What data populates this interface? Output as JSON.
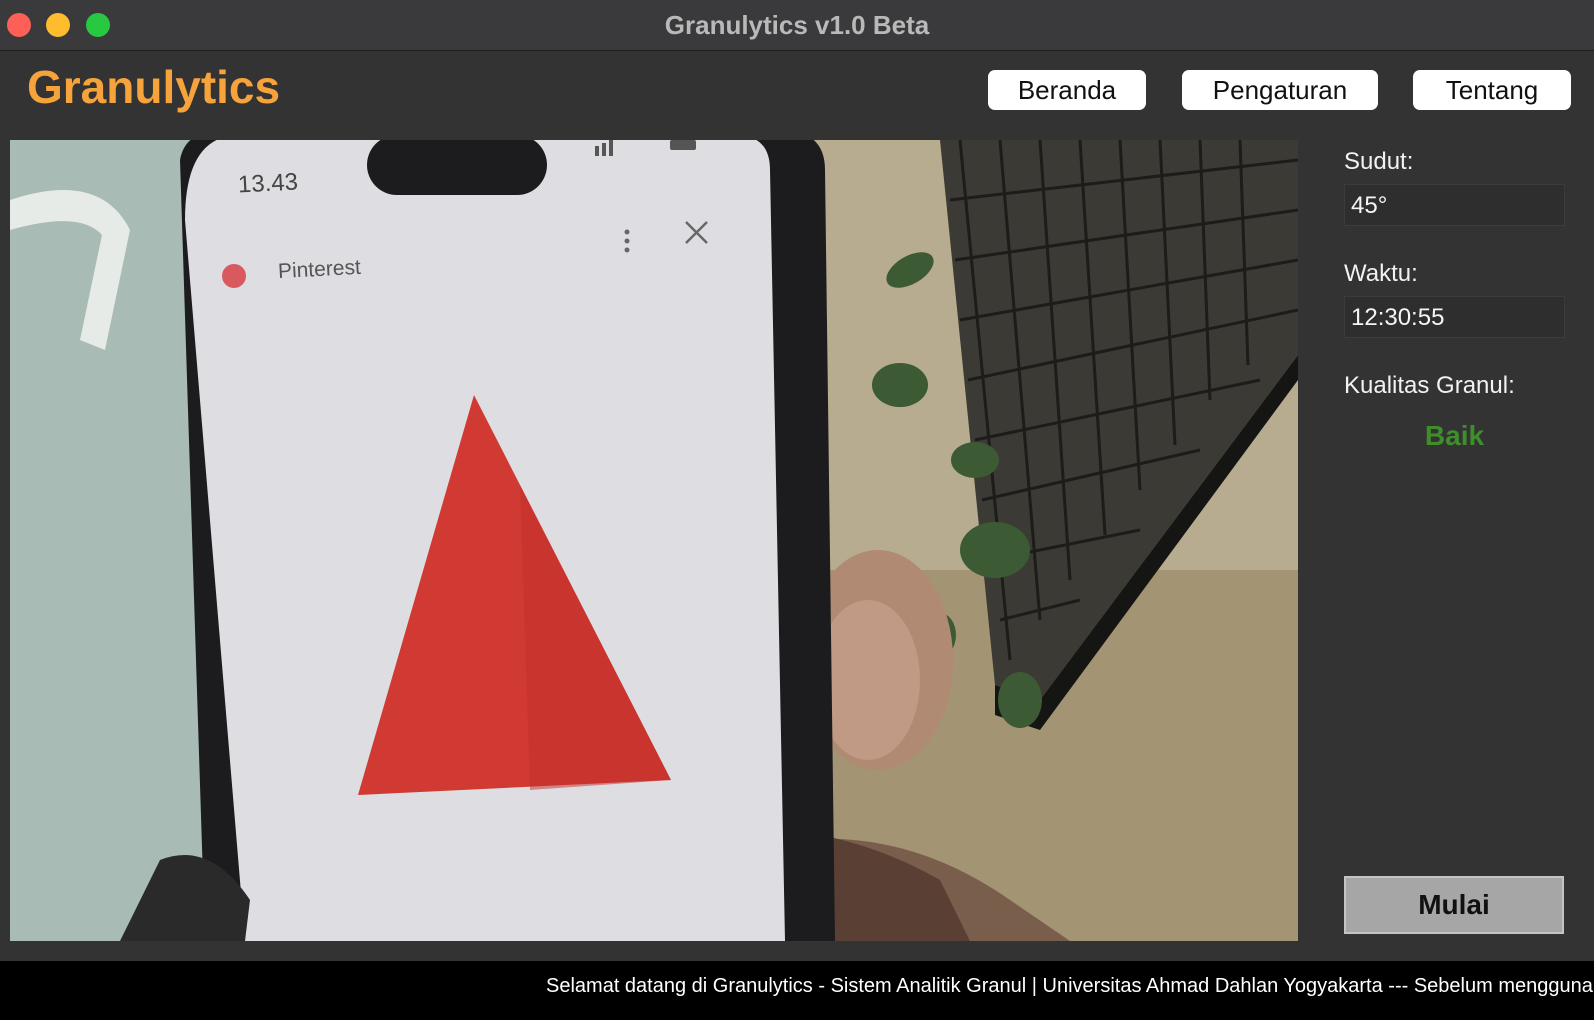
{
  "window": {
    "title": "Granulytics v1.0 Beta"
  },
  "header": {
    "logo": "Granulytics",
    "nav": [
      {
        "label": "Beranda"
      },
      {
        "label": "Pengaturan"
      },
      {
        "label": "Tentang"
      }
    ]
  },
  "camera_feed": {
    "phone_time": "13.43",
    "phone_app": "Pinterest"
  },
  "sidebar": {
    "angle_label": "Sudut:",
    "angle_value": "45°",
    "time_label": "Waktu:",
    "time_value": "12:30:55",
    "quality_label": "Kualitas Granul:",
    "quality_value": "Baik",
    "start_button": "Mulai"
  },
  "ticker": {
    "text": "Selamat datang di Granulytics - Sistem Analitik Granul | Universitas Ahmad Dahlan Yogyakarta --- Sebelum menggunakan"
  },
  "colors": {
    "logo": "#f5a33a",
    "quality_good": "#3e8f2a",
    "background": "#333333",
    "ticker_bg": "#000000"
  }
}
